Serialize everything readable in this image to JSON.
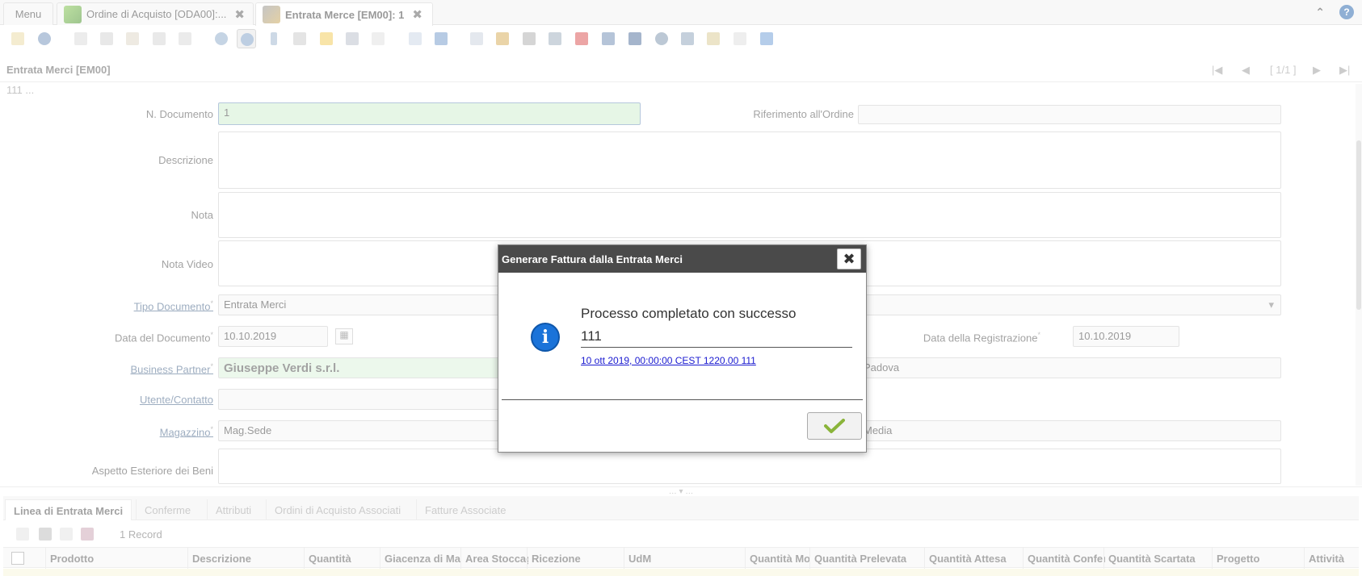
{
  "tabs": [
    {
      "label": "Menu"
    },
    {
      "label": "Ordine di Acquisto [ODA00]:...",
      "close": "✖"
    },
    {
      "label": "Entrata Merce [EM00]: 1",
      "close": "✖"
    }
  ],
  "tabbar_icons": {
    "collapse": "collapse-chevron-icon",
    "help": "?"
  },
  "window": {
    "title": "Entrata Merci [EM00]",
    "record_nav": "[ 1/1 ]",
    "breadcrumb": "111 ..."
  },
  "form": {
    "n_documento": {
      "label": "N. Documento",
      "value": "1"
    },
    "riferimento": {
      "label": "Riferimento all'Ordine",
      "value": ""
    },
    "descrizione": {
      "label": "Descrizione",
      "value": ""
    },
    "nota": {
      "label": "Nota",
      "value": ""
    },
    "nota_video": {
      "label": "Nota Video",
      "value": ""
    },
    "tipo_documento": {
      "label": "Tipo Documento",
      "value": "Entrata Merci"
    },
    "data_documento": {
      "label": "Data del Documento",
      "value": "10.10.2019"
    },
    "data_registrazione": {
      "label": "Data della Registrazione",
      "value": "10.10.2019"
    },
    "business_partner": {
      "label": "Business Partner",
      "value": "Giuseppe Verdi s.r.l."
    },
    "bp_location": {
      "value": "Padova"
    },
    "utente": {
      "label": "Utente/Contatto",
      "value": ""
    },
    "magazzino": {
      "label": "Magazzino",
      "value": "Mag.Sede"
    },
    "priorita": {
      "value": "Media"
    },
    "aspetto": {
      "label": "Aspetto Esteriore dei Beni",
      "value": ""
    }
  },
  "detail_tabs": [
    "Linea di Entrata Merci",
    "Conferme",
    "Attributi",
    "Ordini di Acquisto Associati",
    "Fatture Associate"
  ],
  "records": "1 Record",
  "grid_columns": [
    "Prodotto",
    "Descrizione",
    "Quantità",
    "Giacenza di Ma",
    "Area Stoccag",
    "Ricezione",
    "UdM",
    "Quantità Mo",
    "Quantità Prelevata",
    "Quantità Attesa",
    "Quantità Confer",
    "Quantità Scartata",
    "Progetto",
    "Attività"
  ],
  "dialog": {
    "title": "Generare Fattura dalla Entrata Merci",
    "close": "✖",
    "message": "Processo completato con successo",
    "document_no": "111",
    "link": "10 ott 2019, 00:00:00 CEST 1220.00 111",
    "info_glyph": "i"
  },
  "colors": {
    "accent": "#1e5fa8",
    "required_field": "#cdeccd",
    "dialog_header": "#4a4a4a"
  }
}
